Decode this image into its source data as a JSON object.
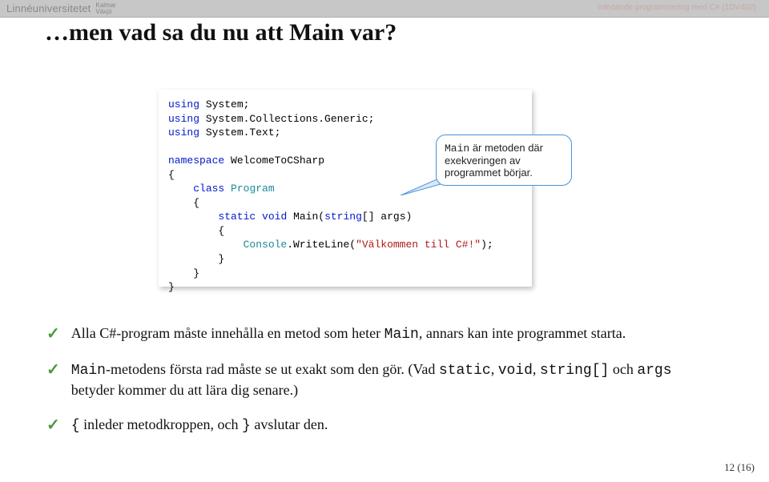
{
  "topbar": {
    "brand": "Linnéuniversitetet",
    "sub1": "Kalmar",
    "sub2": "Växjö"
  },
  "header_note": "Inledande programmering med C# (1DV402)",
  "title": "…men vad sa du nu att Main var?",
  "code": {
    "l1_kw": "using",
    "l1_rest": " System;",
    "l2_kw": "using",
    "l2_rest": " System.Collections.Generic;",
    "l3_kw": "using",
    "l3_rest": " System.Text;",
    "l4_kw": "namespace",
    "l4_rest": " WelcomeToCSharp",
    "l5": "{",
    "l6_pad": "    ",
    "l6_kw": "class",
    "l6_type": " Program",
    "l7": "    {",
    "l8_pad": "        ",
    "l8_kw1": "static",
    "l8_sp1": " ",
    "l8_kw2": "void",
    "l8_sp2": " Main(",
    "l8_kw3": "string",
    "l8_rest": "[] args)",
    "l9": "        {",
    "l10_pad": "            ",
    "l10_type": "Console",
    "l10_mid": ".WriteLine(",
    "l10_str": "\"Välkommen till C#!\"",
    "l10_end": ");",
    "l11": "        }",
    "l12": "    }",
    "l13": "}"
  },
  "callout": {
    "mono": "Main",
    "text": " är metoden där exekveringen av programmet börjar."
  },
  "bullets": {
    "b1_a": "Alla C#-program måste innehålla en metod som heter ",
    "b1_mono": "Main",
    "b1_b": ", annars kan inte programmet starta.",
    "b2_mono1": "Main",
    "b2_a": "-metodens första rad måste se ut exakt som den gör. (Vad ",
    "b2_mono2": "static",
    "b2_b": ", ",
    "b2_mono3": "void",
    "b2_c": ", ",
    "b2_mono4": "string[]",
    "b2_d": " och ",
    "b2_mono5": "args",
    "b2_e": " betyder kommer du att lära dig senare.)",
    "b3_mono1": "{",
    "b3_a": " inleder metodkroppen, och ",
    "b3_mono2": "}",
    "b3_b": " avslutar den."
  },
  "pagenum": "12 (16)"
}
